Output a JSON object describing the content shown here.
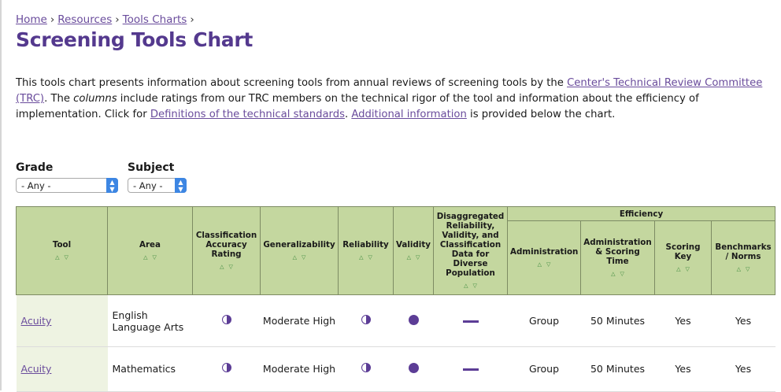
{
  "breadcrumb": {
    "home": "Home",
    "resources": "Resources",
    "tools_charts": "Tools Charts",
    "sep": "›"
  },
  "page_title": "Screening Tools Chart",
  "intro": {
    "part1": "This tools chart presents information about screening tools from annual reviews of screening tools by the ",
    "link_trc": "Center's Technical Review Committee (TRC)",
    "part2": ". The ",
    "columns_word": "columns",
    "part3": " include ratings from our TRC members on the technical rigor of the tool and information about the efficiency of implementation. Click for ",
    "link_definitions": "Definitions of the technical standards",
    "part4": ". ",
    "link_additional": "Additional information",
    "part5": " is provided below the chart."
  },
  "filters": {
    "grade": {
      "label": "Grade",
      "value": "- Any -"
    },
    "subject": {
      "label": "Subject",
      "value": "- Any -"
    }
  },
  "table": {
    "group_header": "Efficiency",
    "sort_arrows": "△▽",
    "headers": {
      "tool": "Tool",
      "area": "Area",
      "classification": "Classification Accuracy Rating",
      "generalizability": "Generalizability",
      "reliability": "Reliability",
      "validity": "Validity",
      "disaggregated": "Disaggregated Reliability, Validity, and Classification Data for Diverse Population",
      "administration": "Administration",
      "admin_scoring_time": "Administration & Scoring Time",
      "scoring_key": "Scoring Key",
      "benchmarks": "Benchmarks / Norms"
    },
    "rows": [
      {
        "tool": "Acuity",
        "area": "English Language Arts",
        "classification_icon": "half-filled-circle",
        "generalizability": "Moderate High",
        "reliability_icon": "half-filled-circle",
        "validity_icon": "filled-circle",
        "disaggregated_icon": "dash",
        "administration": "Group",
        "admin_scoring_time": "50 Minutes",
        "scoring_key": "Yes",
        "benchmarks": "Yes"
      },
      {
        "tool": "Acuity",
        "area": "Mathematics",
        "classification_icon": "half-filled-circle",
        "generalizability": "Moderate High",
        "reliability_icon": "half-filled-circle",
        "validity_icon": "filled-circle",
        "disaggregated_icon": "dash",
        "administration": "Group",
        "admin_scoring_time": "50 Minutes",
        "scoring_key": "Yes",
        "benchmarks": "Yes"
      }
    ]
  },
  "colors": {
    "title_purple": "#54398e",
    "link_purple": "#6a4c9c",
    "rating_purple": "#5c3d96",
    "header_green": "#c4d79f",
    "tool_cell_green": "#eef3e2",
    "select_blue": "#3d86e3"
  }
}
